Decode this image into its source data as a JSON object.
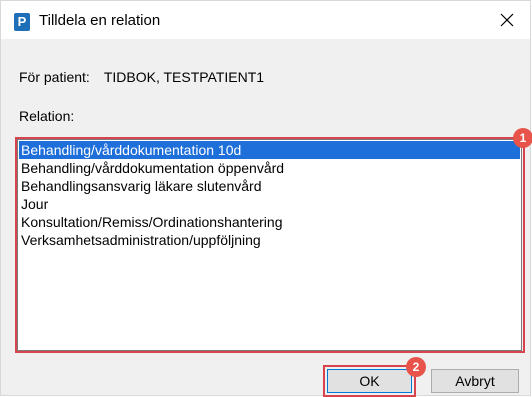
{
  "window": {
    "title": "Tilldela en relation",
    "app_icon_letter": "P",
    "icon": "app-icon",
    "close_icon": "close-icon"
  },
  "patient": {
    "label": "För patient:",
    "value": "TIDBOK, TESTPATIENT1"
  },
  "relation": {
    "label": "Relation:",
    "items": [
      {
        "label": "Behandling/vårddokumentation 10d",
        "selected": true
      },
      {
        "label": "Behandling/vårddokumentation öppenvård",
        "selected": false
      },
      {
        "label": "Behandlingsansvarig läkare slutenvård",
        "selected": false
      },
      {
        "label": "Jour",
        "selected": false
      },
      {
        "label": "Konsultation/Remiss/Ordinationshantering",
        "selected": false
      },
      {
        "label": "Verksamhetsadministration/uppföljning",
        "selected": false
      }
    ]
  },
  "buttons": {
    "ok_label": "OK",
    "cancel_label": "Avbryt"
  },
  "annotations": {
    "badge_1": "1",
    "badge_2": "2",
    "highlight_color": "#d9434e"
  },
  "colors": {
    "selection": "#1e6fd9",
    "app_icon": "#1f6fb8",
    "badge": "#e8544a"
  }
}
